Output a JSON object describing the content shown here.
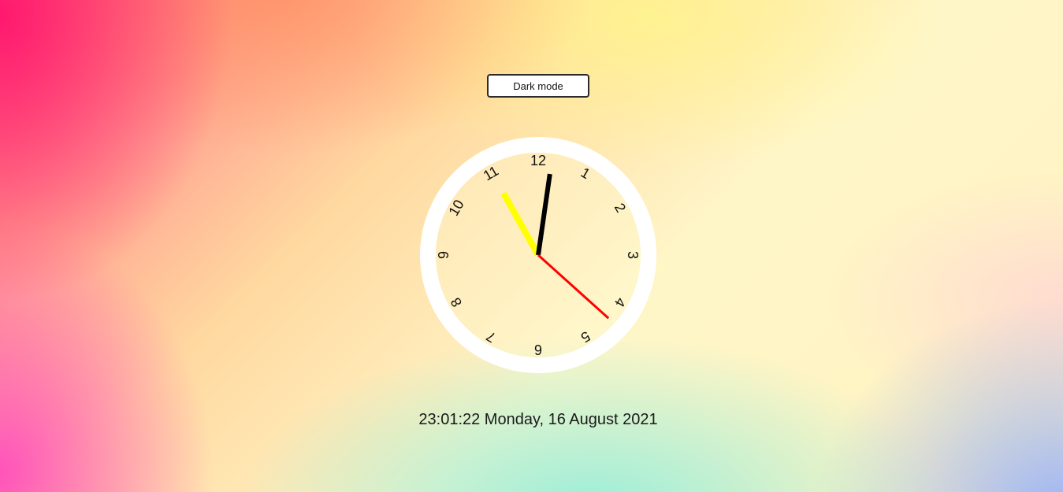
{
  "toggle": {
    "label": "Dark mode"
  },
  "clock": {
    "numerals": [
      "12",
      "1",
      "2",
      "3",
      "4",
      "5",
      "6",
      "7",
      "8",
      "9",
      "10",
      "11"
    ],
    "time": {
      "hours": 23,
      "minutes": 1,
      "seconds": 22
    },
    "colors": {
      "ring": "#ffffff",
      "face": "#fdf6cf",
      "hour_hand": "#ffff00",
      "minute_hand": "#000000",
      "second_hand": "#ff0000",
      "numerals": "#111111"
    }
  },
  "datetime": {
    "text": "23:01:22 Monday, 16 August 2021"
  }
}
